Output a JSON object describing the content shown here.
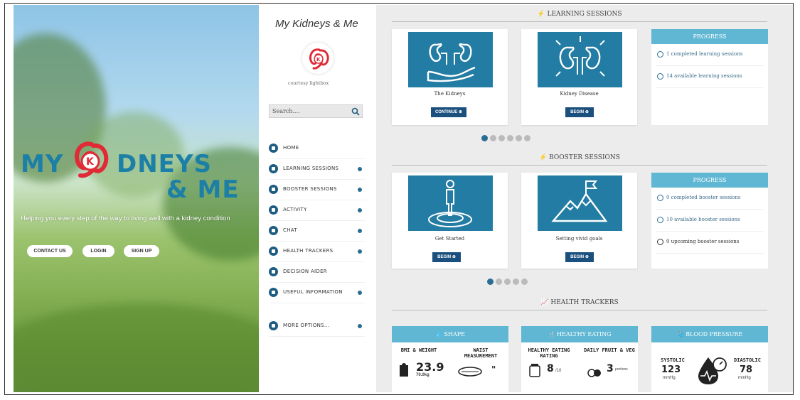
{
  "hero": {
    "logo_my": "MY",
    "logo_dneys": "DNEYS",
    "logo_me": "& ME",
    "tagline": "Helping you every step of the way to living well with a kidney condition",
    "buttons": [
      "CONTACT US",
      "LOGIN",
      "SIGN UP"
    ]
  },
  "sidebar": {
    "brand_title": "My Kidneys & Me",
    "courtesy": "courtesy lightbox",
    "search_placeholder": "Search....",
    "menu": [
      {
        "label": "HOME",
        "chevron": false
      },
      {
        "label": "LEARNING SESSIONS",
        "chevron": true
      },
      {
        "label": "BOOSTER SESSIONS",
        "chevron": true
      },
      {
        "label": "ACTIVITY",
        "chevron": true
      },
      {
        "label": "CHAT",
        "chevron": true
      },
      {
        "label": "HEALTH TRACKERS",
        "chevron": true
      },
      {
        "label": "DECISION AIDER",
        "chevron": false
      },
      {
        "label": "USEFUL INFORMATION",
        "chevron": true
      },
      {
        "label": "MORE OPTIONS...",
        "chevron": true
      }
    ]
  },
  "learning": {
    "heading": "LEARNING SESSIONS",
    "cards": [
      {
        "caption": "The Kidneys",
        "button": "CONTINUE",
        "icon": "kidneys-hand-icon"
      },
      {
        "caption": "Kidney Disease",
        "button": "BEGIN",
        "icon": "kidney-disease-icon"
      }
    ],
    "progress": {
      "title": "PROGRESS",
      "rows": [
        "1 completed learning sessions",
        "14 available learning sessions"
      ]
    },
    "dots": 6,
    "active_dot": 0
  },
  "booster": {
    "heading": "BOOSTER SESSIONS",
    "cards": [
      {
        "caption": "Get Started",
        "button": "BEGIN",
        "icon": "person-target-icon"
      },
      {
        "caption": "Setting vivid goals",
        "button": "BEGIN",
        "icon": "mountain-flag-icon"
      }
    ],
    "progress": {
      "title": "PROGRESS",
      "rows": [
        "0 completed booster sessions",
        "10 available booster sessions",
        "0 upcoming booster sessions"
      ]
    },
    "dots": 5,
    "active_dot": 0
  },
  "trackers": {
    "heading": "HEALTH TRACKERS",
    "shape": {
      "title": "SHAPE",
      "metric1_label": "BMI & WEIGHT",
      "metric1_value": "23.9",
      "metric1_sub": "70.0kg",
      "metric2_label": "WAIST MEASUREMENT",
      "metric2_value": "\""
    },
    "eating": {
      "title": "HEALTHY EATING",
      "metric1_label": "HEALTHY EATING RATING",
      "metric1_value": "8",
      "metric1_unit": "/10",
      "metric2_label": "DAILY FRUIT & VEG",
      "metric2_value": "3",
      "metric2_unit": "portions"
    },
    "bp": {
      "title": "BLOOD PRESSURE",
      "systolic_label": "SYSTOLIC",
      "systolic_value": "123",
      "systolic_unit": "mmHg",
      "diastolic_label": "DIASTOLIC",
      "diastolic_value": "78",
      "diastolic_unit": "mmHg"
    }
  },
  "colors": {
    "teal": "#237ca3",
    "navy": "#1b4f7d",
    "header_blue": "#5fb7d3",
    "logo_red": "#e02b36",
    "logo_blue": "#1c7fa6"
  }
}
